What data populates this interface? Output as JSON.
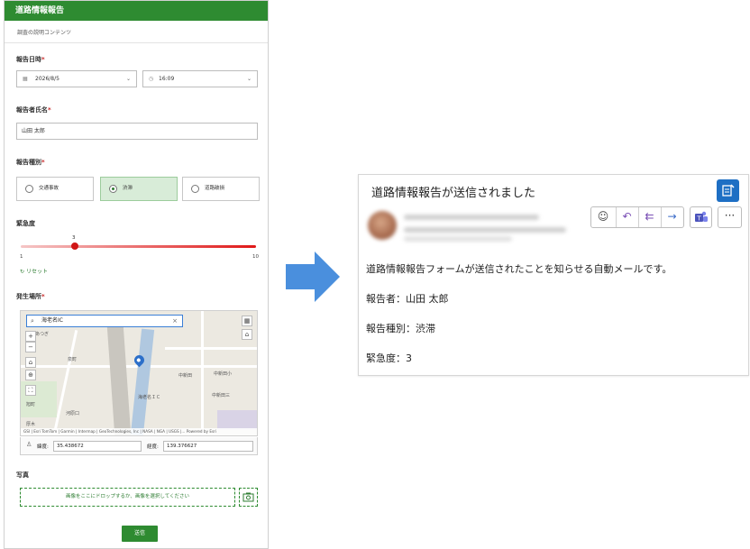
{
  "form": {
    "header": "道路情報報告",
    "subtitle": "調査の説明コンテンツ",
    "report_datetime": {
      "label": "報告日時",
      "date": "2026/8/5",
      "time": "16:09"
    },
    "reporter_name": {
      "label": "報告者氏名",
      "value": "山田 太郎"
    },
    "report_type": {
      "label": "報告種別",
      "options": [
        "交通事故",
        "渋滞",
        "道路破損"
      ],
      "selected": "渋滞"
    },
    "urgency": {
      "label": "緊急度",
      "value": "3",
      "min": "1",
      "max": "10",
      "reset": "リセット"
    },
    "location": {
      "label": "発生場所",
      "search_value": "海老名IC",
      "map_labels": [
        "あつぎ",
        "泉町",
        "河原口",
        "中新田",
        "中新田三",
        "海老名ＩＣ",
        "厚木",
        "旭町",
        "中新田小"
      ],
      "attribution": "GSI | Esri TomTom | Garmin | Intermap | GeoTechnologies, Inc | NASA | NGA | USGS |...   Powered by Esri",
      "latitude_label": "緯度:",
      "latitude": "35.438672",
      "longitude_label": "経度:",
      "longitude": "139.376627"
    },
    "photo": {
      "label": "写真",
      "dropzone": "画像をここにドロップするか、画像を選択してください"
    },
    "submit": "送信"
  },
  "mail": {
    "subject": "道路情報報告が送信されました",
    "body": [
      "道路情報報告フォームが送信されたことを知らせる自動メールです。",
      "報告者：山田 太郎",
      "報告種別：渋滞",
      "緊急度：3"
    ],
    "actions": [
      "emoji-icon",
      "reply-icon",
      "reply-all-icon",
      "forward-icon",
      "teams-icon",
      "more-icon"
    ]
  },
  "colors": {
    "form_green": "#2e8b31",
    "arrow_blue": "#4a8fdd",
    "slider_red": "#e01818",
    "mail_accent": "#1e6fc4"
  }
}
